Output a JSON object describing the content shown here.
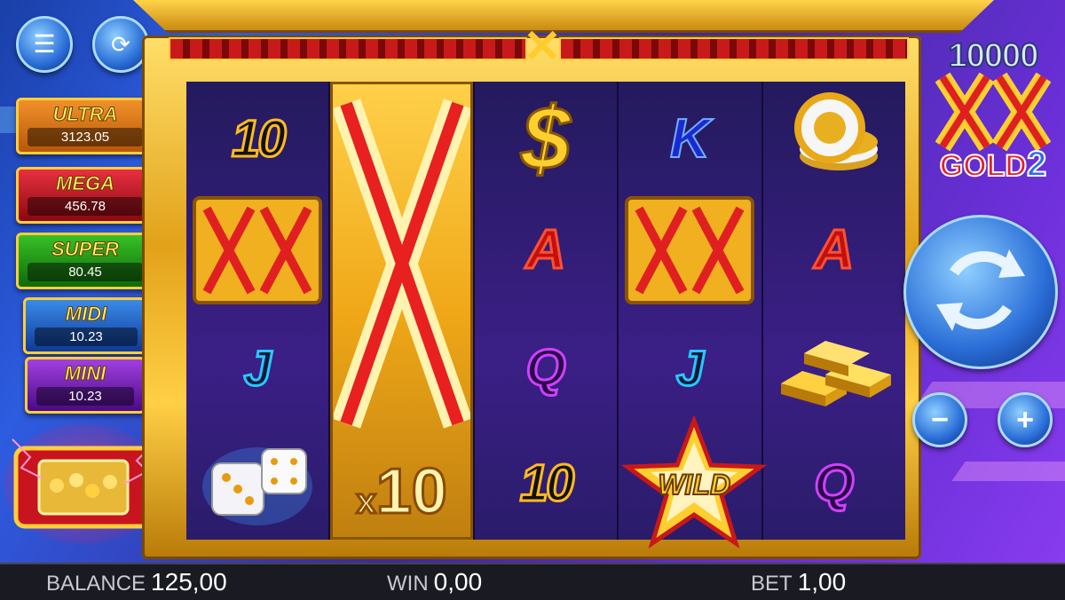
{
  "game": {
    "logo": {
      "top": "10000",
      "bottom": "GOLD",
      "edition": "2"
    }
  },
  "jackpots": [
    {
      "name": "ULTRA",
      "value": "3123.05",
      "color": "#e8781a"
    },
    {
      "name": "MEGA",
      "value": "456.78",
      "color": "#d8202a"
    },
    {
      "name": "SUPER",
      "value": "80.45",
      "color": "#2ea820"
    },
    {
      "name": "MIDI",
      "value": "10.23",
      "color": "#2a78d8"
    },
    {
      "name": "MINI",
      "value": "10.23",
      "color": "#8a2ad0"
    }
  ],
  "reels": {
    "reel1": [
      "10",
      "XX",
      "J",
      "dice"
    ],
    "reel2": [
      "X",
      "x10"
    ],
    "reel3": [
      "$",
      "A",
      "Q",
      "10"
    ],
    "reel4": [
      "K",
      "XX",
      "J",
      "WILD"
    ],
    "reel5": [
      "chips",
      "A",
      "gold-bars",
      "Q"
    ]
  },
  "multiplier": {
    "prefix": "x",
    "value": "10"
  },
  "wild_label": "WILD",
  "status": {
    "balance_label": "BALANCE",
    "balance": "125,00",
    "win_label": "WIN",
    "win": "0,00",
    "bet_label": "BET",
    "bet": "1,00"
  },
  "icons": {
    "menu": "menu-icon",
    "autoplay": "autoplay-icon",
    "spin": "spin-icon",
    "minus": "minus-icon",
    "plus": "plus-icon"
  }
}
